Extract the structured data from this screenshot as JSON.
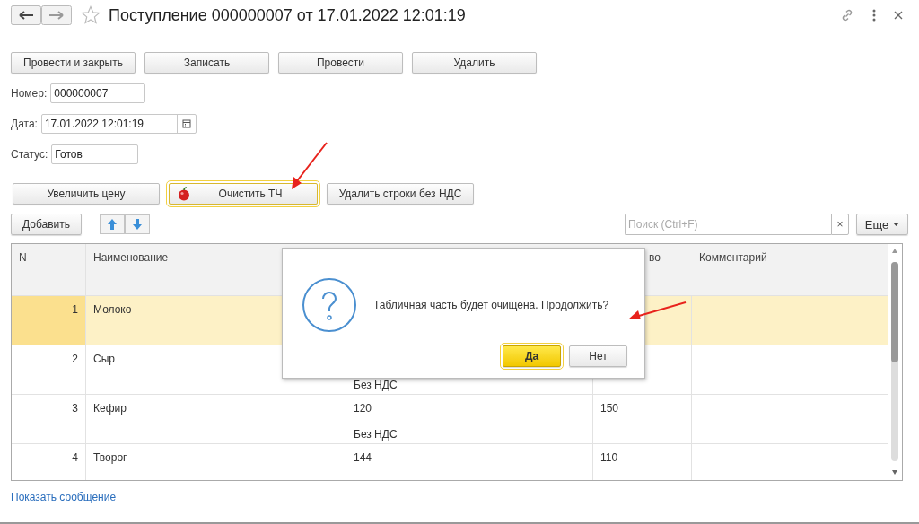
{
  "window": {
    "title": "Поступление 000000007 от 17.01.2022 12:01:19"
  },
  "command_bar": [
    "Провести и закрыть",
    "Записать",
    "Провести",
    "Удалить"
  ],
  "fields": [
    {
      "label": "Номер:",
      "value": "000000007",
      "kind": "text"
    },
    {
      "label": "Дата:",
      "value": "17.01.2022 12:01:19",
      "kind": "date"
    },
    {
      "label": "Статус:",
      "value": "Готов",
      "kind": "text"
    }
  ],
  "form_buttons": [
    {
      "label": "Увеличить цену",
      "selected": false
    },
    {
      "label": "Очистить ТЧ",
      "selected": true
    },
    {
      "label": "Удалить строки без НДС",
      "selected": false
    }
  ],
  "table_toolbar": {
    "add": "Добавить",
    "search": {
      "placeholder": "Поиск (Ctrl+F)"
    },
    "clear": "×",
    "more": "Еще"
  },
  "table": {
    "columns": [
      "N",
      "Наименование",
      "во",
      "Комментарий"
    ],
    "rows": [
      {
        "n": "1",
        "name": "Молоко",
        "selected": true
      },
      {
        "n": "2",
        "name": "Сыр",
        "column_3_line_2": "Без НДС",
        "selected": false
      },
      {
        "n": "3",
        "name": "Кефир",
        "column_3_line_1": "120",
        "column_3_line_2": "Без НДС",
        "column_4": "150",
        "selected": false
      },
      {
        "n": "4",
        "name": "Творог",
        "column_3_line_1": "144",
        "column_4": "110",
        "selected": false
      }
    ]
  },
  "footer_link": "Показать сообщение",
  "dialog": {
    "message": "Табличная часть будет очищена. Продолжить?",
    "buttons": [
      {
        "label": "Да",
        "selected": true
      },
      {
        "label": "Нет",
        "selected": false
      }
    ]
  }
}
